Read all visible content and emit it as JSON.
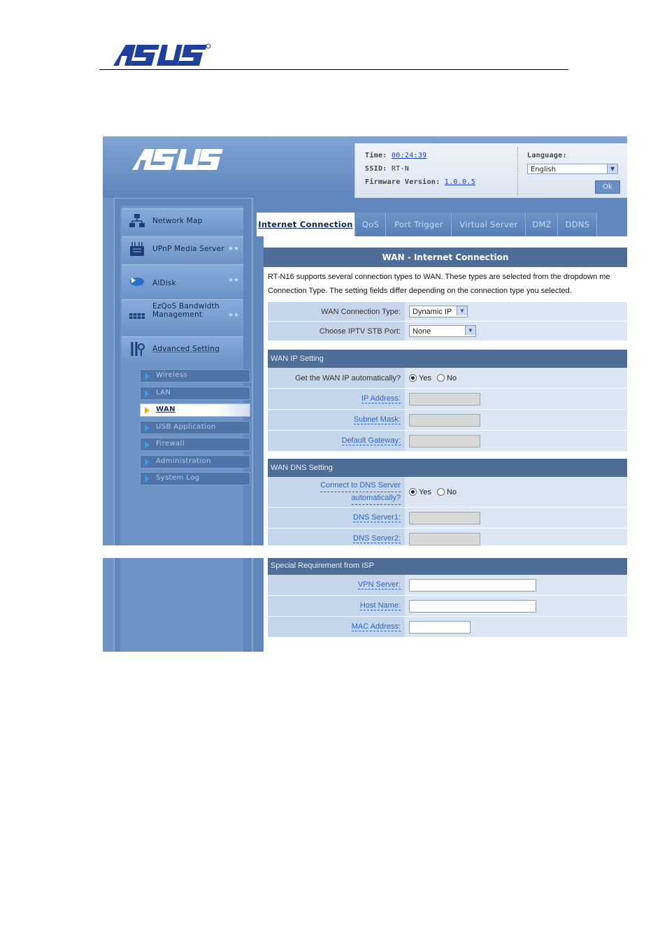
{
  "doc": {
    "brand": "ASUS"
  },
  "header": {
    "time_label": "Time:",
    "time_value": "00:24:39",
    "ssid_label": "SSID:",
    "ssid_value": "RT-N",
    "fw_label": "Firmware Version:",
    "fw_value": "1.0.0.5",
    "language_label": "Language:",
    "language_value": "English",
    "ok_label": "Ok"
  },
  "menu": [
    {
      "label": "Network Map",
      "icon": "network-map-icon"
    },
    {
      "label": "UPnP Media Server",
      "icon": "upnp-media-icon"
    },
    {
      "label": "AiDisk",
      "icon": "aidisk-icon"
    },
    {
      "label": "EzQoS Bandwidth Management",
      "icon": "ezqos-icon"
    },
    {
      "label": "Advanced Setting",
      "icon": "advanced-setting-icon"
    }
  ],
  "submenu": [
    {
      "label": "Wireless"
    },
    {
      "label": "LAN"
    },
    {
      "label": "WAN"
    },
    {
      "label": "USB Application"
    },
    {
      "label": "Firewall"
    },
    {
      "label": "Administration"
    },
    {
      "label": "System Log"
    }
  ],
  "tabs": [
    {
      "label": "Internet Connection"
    },
    {
      "label": "QoS"
    },
    {
      "label": "Port Trigger"
    },
    {
      "label": "Virtual Server"
    },
    {
      "label": "DMZ"
    },
    {
      "label": "DDNS"
    }
  ],
  "wan": {
    "title": "WAN - Internet Connection",
    "intro1": "RT-N16 supports several connection types to WAN. These types are selected from the dropdown me",
    "intro2": "Connection Type. The setting fields differ depending on the connection type you selected.",
    "conn_type_label": "WAN Connection Type:",
    "conn_type_value": "Dynamic IP",
    "iptv_label": "Choose IPTV STB Port:",
    "iptv_value": "None"
  },
  "wan_ip": {
    "title": "WAN IP Setting",
    "auto_label": "Get the WAN IP automatically?",
    "yes": "Yes",
    "no": "No",
    "ip_label": "IP Address:",
    "mask_label": "Subnet Mask:",
    "gw_label": "Default Gateway:"
  },
  "wan_dns": {
    "title": "WAN DNS Setting",
    "auto_label_1": "Connect to DNS Server",
    "auto_label_2": "automatically?",
    "yes": "Yes",
    "no": "No",
    "dns1_label": "DNS Server1:",
    "dns2_label": "DNS Server2:"
  },
  "isp": {
    "title": "Special Requirement from ISP",
    "vpn_label": "VPN Server:",
    "host_label": "Host Name:",
    "mac_label": "MAC Address:"
  }
}
